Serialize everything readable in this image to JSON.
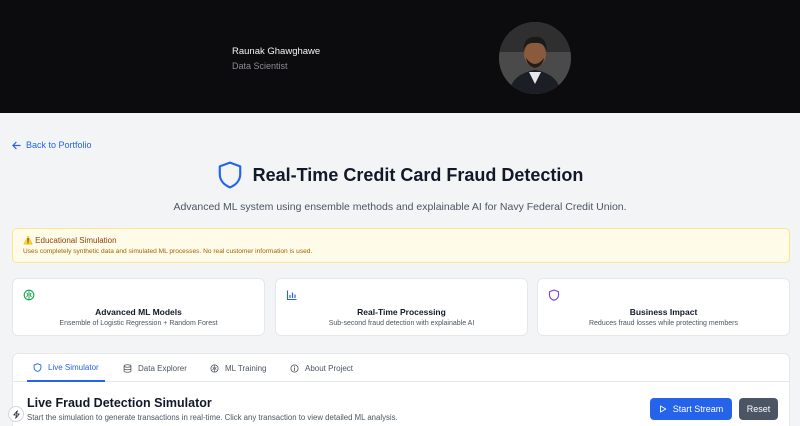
{
  "hero": {
    "name": "Raunak Ghawghawe",
    "role": "Data Scientist"
  },
  "nav": {
    "back_label": "Back to Portfolio"
  },
  "page": {
    "title": "Real-Time Credit Card Fraud Detection",
    "subtitle": "Advanced ML system using ensemble methods and explainable AI for Navy Federal Credit Union."
  },
  "notice": {
    "title": "⚠️ Educational Simulation",
    "text": "Uses completely synthetic data and simulated ML processes. No real customer information is used."
  },
  "cards": [
    {
      "icon": "brain-icon",
      "title": "Advanced ML Models",
      "desc": "Ensemble of Logistic Regression + Random Forest"
    },
    {
      "icon": "bar-chart-icon",
      "title": "Real-Time Processing",
      "desc": "Sub-second fraud detection with explainable AI"
    },
    {
      "icon": "shield-icon",
      "title": "Business Impact",
      "desc": "Reduces fraud losses while protecting members"
    }
  ],
  "tabs": [
    {
      "label": "Live Simulator",
      "icon": "shield-icon",
      "active": true
    },
    {
      "label": "Data Explorer",
      "icon": "database-icon"
    },
    {
      "label": "ML Training",
      "icon": "brain-icon"
    },
    {
      "label": "About Project",
      "icon": "info-icon"
    }
  ],
  "simulator": {
    "title": "Live Fraud Detection Simulator",
    "desc": "Start the simulation to generate transactions in real-time. Click any transaction to view detailed ML analysis.",
    "start_label": "Start Stream",
    "reset_label": "Reset"
  },
  "colors": {
    "accent": "#2563eb",
    "hero_bg": "#0c0c0e",
    "notice_bg": "#fefce8",
    "brain_green": "#16a34a",
    "chart_blue": "#2563eb",
    "shield_purple": "#7c3aed"
  }
}
